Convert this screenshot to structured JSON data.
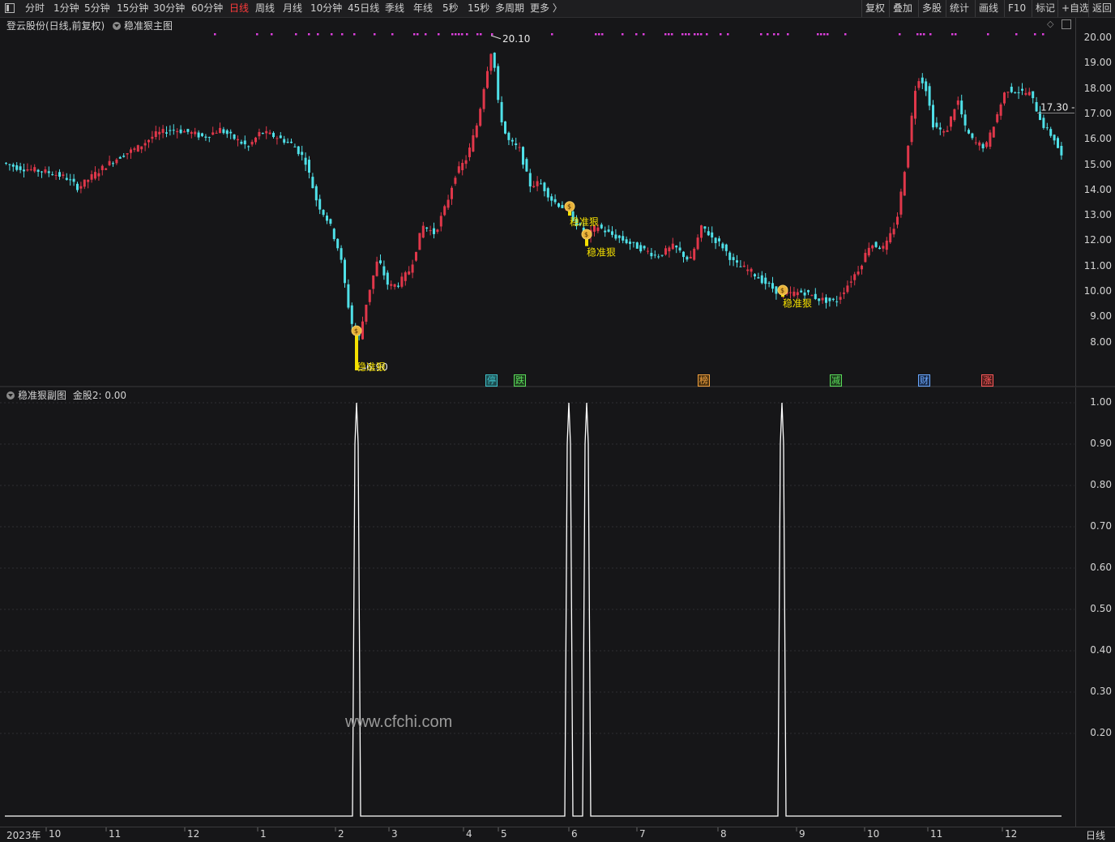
{
  "toolbar": {
    "left_items": [
      "分时",
      "1分钟",
      "5分钟",
      "15分钟",
      "30分钟",
      "60分钟",
      "日线",
      "周线",
      "月线",
      "10分钟",
      "45日线",
      "季线",
      "年线",
      "5秒",
      "15秒",
      "多周期",
      "更多 〉"
    ],
    "active": "日线",
    "right_items": [
      "复权",
      "叠加",
      "多股",
      "统计",
      "画线",
      "F10",
      "标记",
      "+自选",
      "返回"
    ]
  },
  "main_panel": {
    "stock": "登云股份(日线,前复权)",
    "indicator": "稳准狠主图",
    "price_high_label": "20.10",
    "price_low_label": "6.90",
    "current_price": "17.30",
    "signal_text": "稳准狠",
    "tags": [
      {
        "text": "停",
        "color": "#3fc1c9",
        "bg": "#1d4d50"
      },
      {
        "text": "跌",
        "color": "#5adc5a",
        "bg": "#1d3a1d"
      },
      {
        "text": "榜",
        "color": "#f0a040",
        "bg": "#4a3210"
      },
      {
        "text": "减",
        "color": "#5adc5a",
        "bg": "#1d3a1d"
      },
      {
        "text": "财",
        "color": "#6aa8ff",
        "bg": "#1c2e4d"
      },
      {
        "text": "涨",
        "color": "#ff5a5a",
        "bg": "#4a1b1b"
      }
    ]
  },
  "sub_panel": {
    "indicator": "稳准狠副图",
    "value_label": "金股2: 0.00"
  },
  "watermark": "www.cfchi.com",
  "period_label": "日线",
  "colors": {
    "up": "#e0374a",
    "down": "#4fe0e8",
    "signal": "#f5e000",
    "line": "#ffffff",
    "purple": "#e040e0"
  },
  "chart_data": [
    {
      "type": "candlestick",
      "title": "稳准狠主图",
      "ylim": [
        7.3,
        20.4
      ],
      "yticks": [
        "20.00",
        "19.00",
        "18.00",
        "17.00",
        "16.00",
        "15.00",
        "14.00",
        "13.00",
        "12.00",
        "11.00",
        "10.00",
        "9.00",
        "8.00"
      ],
      "x_labels": [
        "2023年",
        "10",
        "11",
        "12",
        "1",
        "2",
        "3",
        "4",
        "5",
        "6",
        "7",
        "8",
        "9",
        "10",
        "11",
        "12"
      ],
      "close_path": [
        [
          0,
          15.1
        ],
        [
          20,
          14.9
        ],
        [
          40,
          14.8
        ],
        [
          60,
          14.7
        ],
        [
          80,
          14.5
        ],
        [
          95,
          14.1
        ],
        [
          110,
          14.5
        ],
        [
          130,
          15.0
        ],
        [
          150,
          15.4
        ],
        [
          170,
          15.7
        ],
        [
          190,
          16.2
        ],
        [
          210,
          16.4
        ],
        [
          230,
          16.3
        ],
        [
          250,
          16.1
        ],
        [
          270,
          16.4
        ],
        [
          290,
          16.0
        ],
        [
          305,
          15.7
        ],
        [
          320,
          16.3
        ],
        [
          340,
          16.1
        ],
        [
          360,
          15.8
        ],
        [
          375,
          15.2
        ],
        [
          390,
          13.5
        ],
        [
          405,
          12.7
        ],
        [
          418,
          11.5
        ],
        [
          428,
          9.5
        ],
        [
          435,
          8.4
        ],
        [
          442,
          8.2
        ],
        [
          452,
          9.8
        ],
        [
          465,
          11.3
        ],
        [
          478,
          10.2
        ],
        [
          490,
          10.3
        ],
        [
          505,
          10.9
        ],
        [
          520,
          12.6
        ],
        [
          535,
          12.3
        ],
        [
          550,
          13.5
        ],
        [
          560,
          14.6
        ],
        [
          575,
          15.3
        ],
        [
          588,
          16.7
        ],
        [
          598,
          18.5
        ],
        [
          606,
          19.7
        ],
        [
          614,
          17.2
        ],
        [
          624,
          16.0
        ],
        [
          640,
          15.6
        ],
        [
          652,
          14.2
        ],
        [
          665,
          14.3
        ],
        [
          680,
          13.6
        ],
        [
          695,
          13.3
        ],
        [
          703,
          13.0
        ],
        [
          715,
          12.5
        ],
        [
          724,
          12.2
        ],
        [
          735,
          12.6
        ],
        [
          750,
          12.3
        ],
        [
          770,
          12.0
        ],
        [
          790,
          11.7
        ],
        [
          810,
          11.4
        ],
        [
          830,
          11.8
        ],
        [
          850,
          11.2
        ],
        [
          865,
          12.6
        ],
        [
          875,
          12.2
        ],
        [
          890,
          11.8
        ],
        [
          905,
          11.1
        ],
        [
          925,
          10.8
        ],
        [
          945,
          10.3
        ],
        [
          958,
          10.0
        ],
        [
          970,
          9.9
        ],
        [
          990,
          10.0
        ],
        [
          1010,
          9.7
        ],
        [
          1030,
          9.6
        ],
        [
          1045,
          10.3
        ],
        [
          1060,
          11.0
        ],
        [
          1072,
          11.9
        ],
        [
          1090,
          11.7
        ],
        [
          1105,
          12.8
        ],
        [
          1113,
          14.4
        ],
        [
          1122,
          16.5
        ],
        [
          1130,
          18.5
        ],
        [
          1140,
          18.2
        ],
        [
          1150,
          16.6
        ],
        [
          1165,
          16.2
        ],
        [
          1180,
          17.6
        ],
        [
          1190,
          16.4
        ],
        [
          1200,
          15.9
        ],
        [
          1215,
          15.7
        ],
        [
          1225,
          16.6
        ],
        [
          1240,
          18.0
        ],
        [
          1255,
          17.9
        ],
        [
          1270,
          17.8
        ],
        [
          1285,
          16.6
        ],
        [
          1300,
          16.0
        ],
        [
          1310,
          15.2
        ]
      ],
      "high_point": 20.1,
      "low_point": 6.9,
      "last_price": 17.3,
      "signal_markers": [
        {
          "x": 440,
          "low": 6.9,
          "high": 8.4,
          "label": "稳准狠"
        },
        {
          "x": 703,
          "low": 13.0,
          "high": 13.3,
          "label": "稳准狠"
        },
        {
          "x": 724,
          "low": 11.8,
          "high": 12.2,
          "label": "稳准狠"
        },
        {
          "x": 966,
          "low": 9.8,
          "high": 10.0,
          "label": "稳准狠"
        }
      ]
    },
    {
      "type": "line",
      "title": "稳准狠副图",
      "series": [
        {
          "name": "金股2",
          "spikes_at_x": [
            440,
            702,
            724,
            965
          ],
          "baseline": 0,
          "peak": 1
        }
      ],
      "ylim": [
        -0.1,
        1.0
      ],
      "yticks": [
        "1.00",
        "0.90",
        "0.80",
        "0.70",
        "0.60",
        "0.50",
        "0.40",
        "0.30",
        "0.20"
      ],
      "value": 0.0
    }
  ]
}
